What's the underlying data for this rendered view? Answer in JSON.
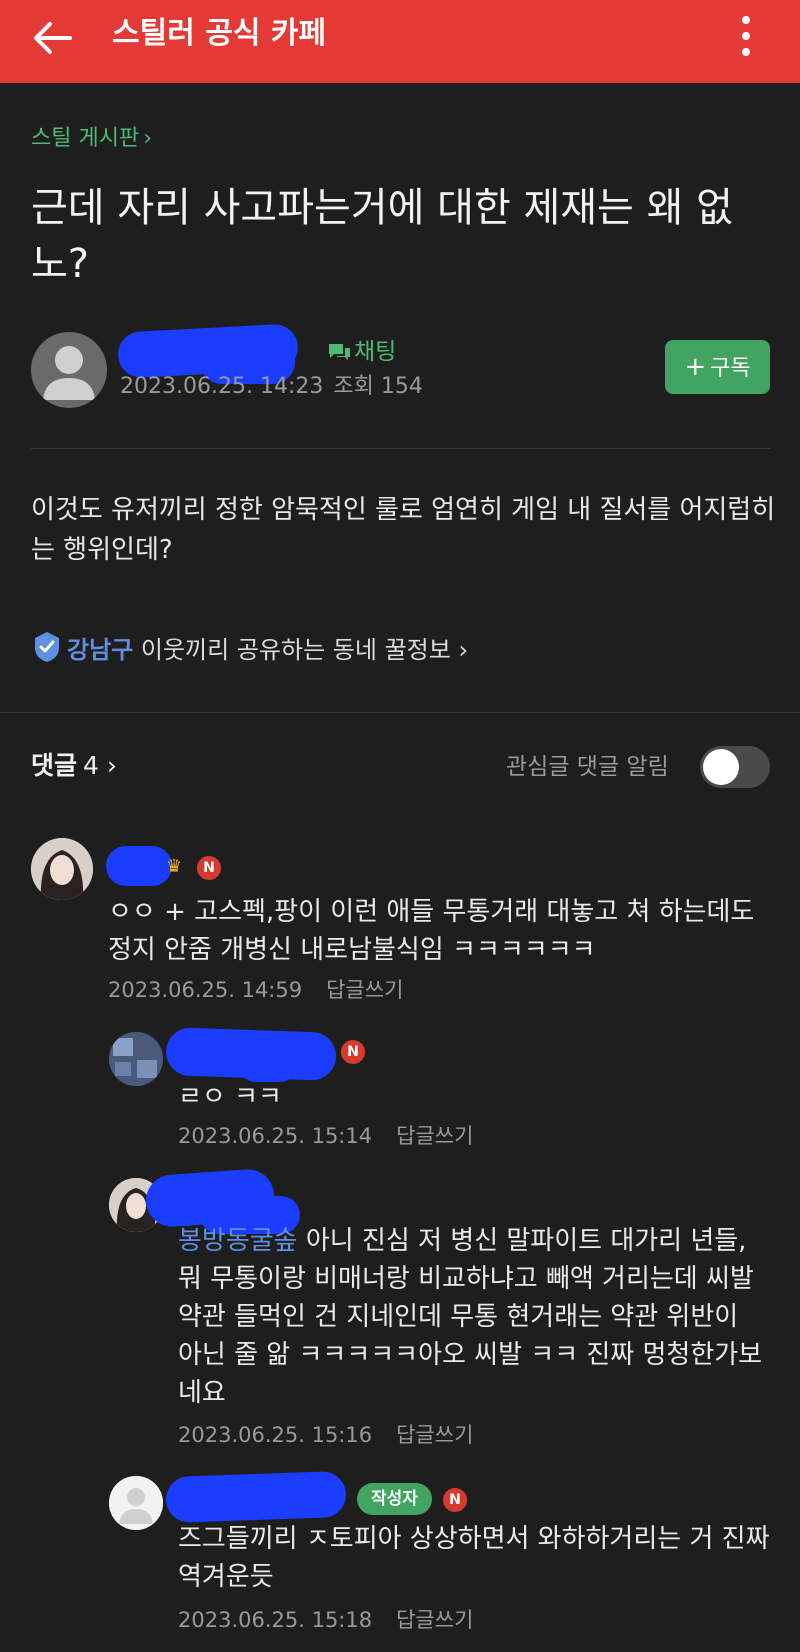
{
  "header": {
    "title": "스틸러 공식 카페"
  },
  "post": {
    "board": "스틸 게시판",
    "title": "근데 자리 사고파는거에 대한 제재는 왜 없노?",
    "chat_label": "채팅",
    "date": "2023.06.25. 14:23",
    "views_label": "조회",
    "views": "154",
    "subscribe_label": "구독",
    "body": "이것도 유저끼리 정한 암묵적인 룰로 엄연히 게임 내 질서를 어지럽히는 행위인데?"
  },
  "local": {
    "location": "강남구",
    "text": "이웃끼리 공유하는 동네 꿀정보"
  },
  "comments_section": {
    "label": "댓글",
    "count": "4",
    "notify_label": "관심글 댓글 알림",
    "notify_on": false
  },
  "comments": [
    {
      "badge": "N",
      "text": "ㅇㅇ + 고스펙,팡이 이런 애들 무통거래 대놓고 쳐 하는데도 정지 안줌 개병신 내로남불식임 ㅋㅋㅋㅋㅋㅋ",
      "date": "2023.06.25. 14:59",
      "reply_label": "답글쓰기"
    },
    {
      "badge": "N",
      "text": "ㄹㅇ ㅋㅋ",
      "date": "2023.06.25. 15:14",
      "reply_label": "답글쓰기"
    },
    {
      "mention": "봉방동굴솦",
      "text": " 아니 진심 저 병신 말파이트 대가리 년들, 뭐 무통이랑 비매너랑 비교하냐고 빼액 거리는데 씨발 약관 들먹인 건 지네인데 무통 현거래는 약관 위반이 아닌 줄 앎 ㅋㅋㅋㅋㅋ아오 씨발 ㅋㅋ 진짜 멍청한가보네요",
      "date": "2023.06.25. 15:16",
      "reply_label": "답글쓰기"
    },
    {
      "author_badge": "작성자",
      "badge": "N",
      "text": "즈그들끼리 ㅈ토피아 상상하면서 와하하거리는 거 진짜 역겨운듯",
      "date": "2023.06.25. 15:18",
      "reply_label": "답글쓰기"
    }
  ],
  "colors": {
    "header": "#e53935",
    "background": "#1e1e1e",
    "accent_green": "#41a561",
    "mention_blue": "#5e8fe0",
    "redaction": "#1a3dff"
  },
  "icons": [
    "back-arrow-icon",
    "more-vertical-icon",
    "chat-bubble-icon",
    "plus-icon",
    "location-check-icon",
    "chevron-right-icon",
    "crown-icon",
    "new-badge-icon"
  ]
}
